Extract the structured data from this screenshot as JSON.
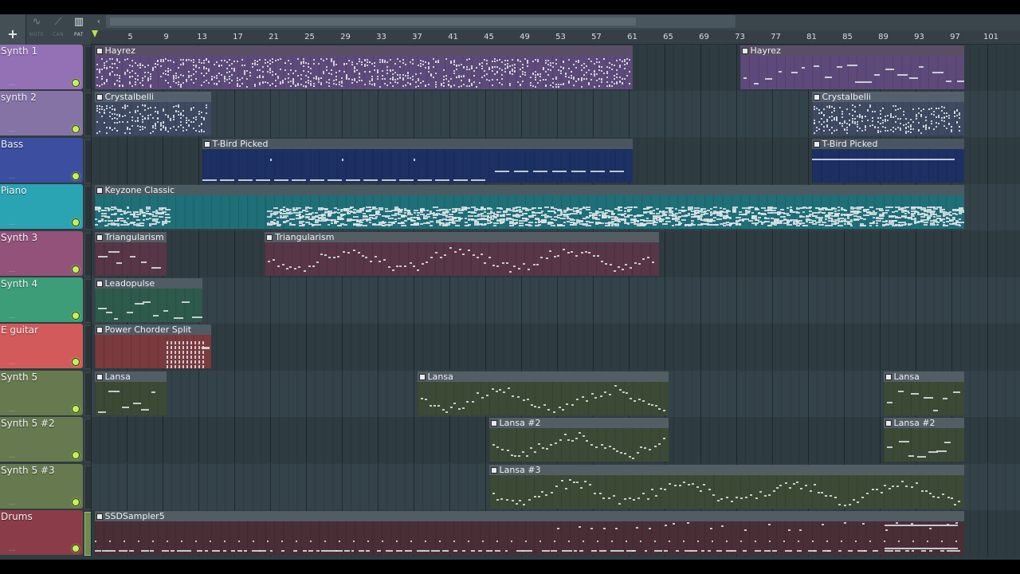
{
  "toolbar": {
    "add_label": "+",
    "tools": [
      {
        "name": "note-tool",
        "icon": "wave-icon",
        "glyph": "∿",
        "label": "NOTE",
        "active": false
      },
      {
        "name": "can-tool",
        "icon": "cable-icon",
        "glyph": "⟋",
        "label": "CAN",
        "active": false
      },
      {
        "name": "pat-tool",
        "icon": "piano-icon",
        "glyph": "▥",
        "label": "PAT",
        "active": true
      }
    ],
    "scroll_left_glyph": "‹"
  },
  "ruler": {
    "bars": [
      "5",
      "9",
      "13",
      "17",
      "21",
      "25",
      "29",
      "33",
      "37",
      "41",
      "45",
      "49",
      "53",
      "57",
      "61",
      "65",
      "69",
      "73",
      "77",
      "81",
      "85",
      "89",
      "93",
      "97",
      "101"
    ]
  },
  "tracks": [
    {
      "name": "Synth 1",
      "color": "#9470b4",
      "clip_color": "#5e4a7a",
      "clip_title_color": "#5a4e66",
      "clips": [
        {
          "title": "Hayrez",
          "start": 1,
          "end": 61,
          "pattern": "dense"
        },
        {
          "title": "Hayrez",
          "start": 73,
          "end": 98,
          "pattern": "sparse"
        }
      ]
    },
    {
      "name": "synth 2",
      "color": "#8673a6",
      "clip_color": "#3f4962",
      "clip_title_color": "#55606d",
      "clips": [
        {
          "title": "Crystalbelli",
          "start": 1,
          "end": 14,
          "pattern": "dense"
        },
        {
          "title": "Crystalbelli",
          "start": 81,
          "end": 98,
          "pattern": "dense"
        }
      ]
    },
    {
      "name": "Bass",
      "color": "#3c4ea0",
      "clip_color": "#1d3064",
      "clip_title_color": "#4a5560",
      "clips": [
        {
          "title": "T-Bird Picked",
          "start": 13,
          "end": 61,
          "pattern": "bass"
        },
        {
          "title": "T-Bird Picked",
          "start": 81,
          "end": 98,
          "pattern": "line"
        }
      ]
    },
    {
      "name": "Piano",
      "color": "#2aa3b3",
      "clip_color": "#1f6f78",
      "clip_title_color": "#4c5a62",
      "clips": [
        {
          "title": "Keyzone Classic",
          "start": 1,
          "end": 98,
          "pattern": "piano"
        }
      ]
    },
    {
      "name": "Synth 3",
      "color": "#93527a",
      "clip_color": "#573647",
      "clip_title_color": "#545c64",
      "clips": [
        {
          "title": "Triangularism",
          "start": 1,
          "end": 9,
          "pattern": "sparse"
        },
        {
          "title": "Triangularism",
          "start": 20,
          "end": 64,
          "pattern": "wave"
        }
      ]
    },
    {
      "name": "Synth 4",
      "color": "#3c9d78",
      "clip_color": "#2d5a4b",
      "clip_title_color": "#505b63",
      "clips": [
        {
          "title": "Leadopulse",
          "start": 1,
          "end": 13,
          "pattern": "sparse"
        }
      ]
    },
    {
      "name": "E guitar",
      "color": "#d35a5a",
      "clip_color": "#7a3a3e",
      "clip_title_color": "#515b63",
      "clips": [
        {
          "title": "Power Chorder Split",
          "start": 1,
          "end": 14,
          "pattern": "chords"
        }
      ]
    },
    {
      "name": "Synth 5",
      "color": "#67794f",
      "clip_color": "#3c4a35",
      "clip_title_color": "#535d64",
      "clips": [
        {
          "title": "Lansa",
          "start": 1,
          "end": 9,
          "pattern": "sparse"
        },
        {
          "title": "Lansa",
          "start": 37,
          "end": 65,
          "pattern": "wave"
        },
        {
          "title": "Lansa",
          "start": 89,
          "end": 98,
          "pattern": "sparse"
        }
      ]
    },
    {
      "name": "Synth 5 #2",
      "color": "#67794f",
      "clip_color": "#3c4a35",
      "clip_title_color": "#535d64",
      "clips": [
        {
          "title": "Lansa #2",
          "start": 45,
          "end": 65,
          "pattern": "wave"
        },
        {
          "title": "Lansa #2",
          "start": 89,
          "end": 98,
          "pattern": "sparse"
        }
      ]
    },
    {
      "name": "Synth 5 #3",
      "color": "#67794f",
      "clip_color": "#3c4a35",
      "clip_title_color": "#535d64",
      "clips": [
        {
          "title": "Lansa #3",
          "start": 45,
          "end": 98,
          "pattern": "wave"
        }
      ]
    },
    {
      "name": "Drums",
      "color": "#8a3d48",
      "clip_color": "#4a2e36",
      "clip_title_color": "#525c63",
      "clips": [
        {
          "title": "SSDSampler5",
          "start": 1,
          "end": 98,
          "pattern": "drums"
        }
      ]
    }
  ],
  "selected_track": "Drums"
}
